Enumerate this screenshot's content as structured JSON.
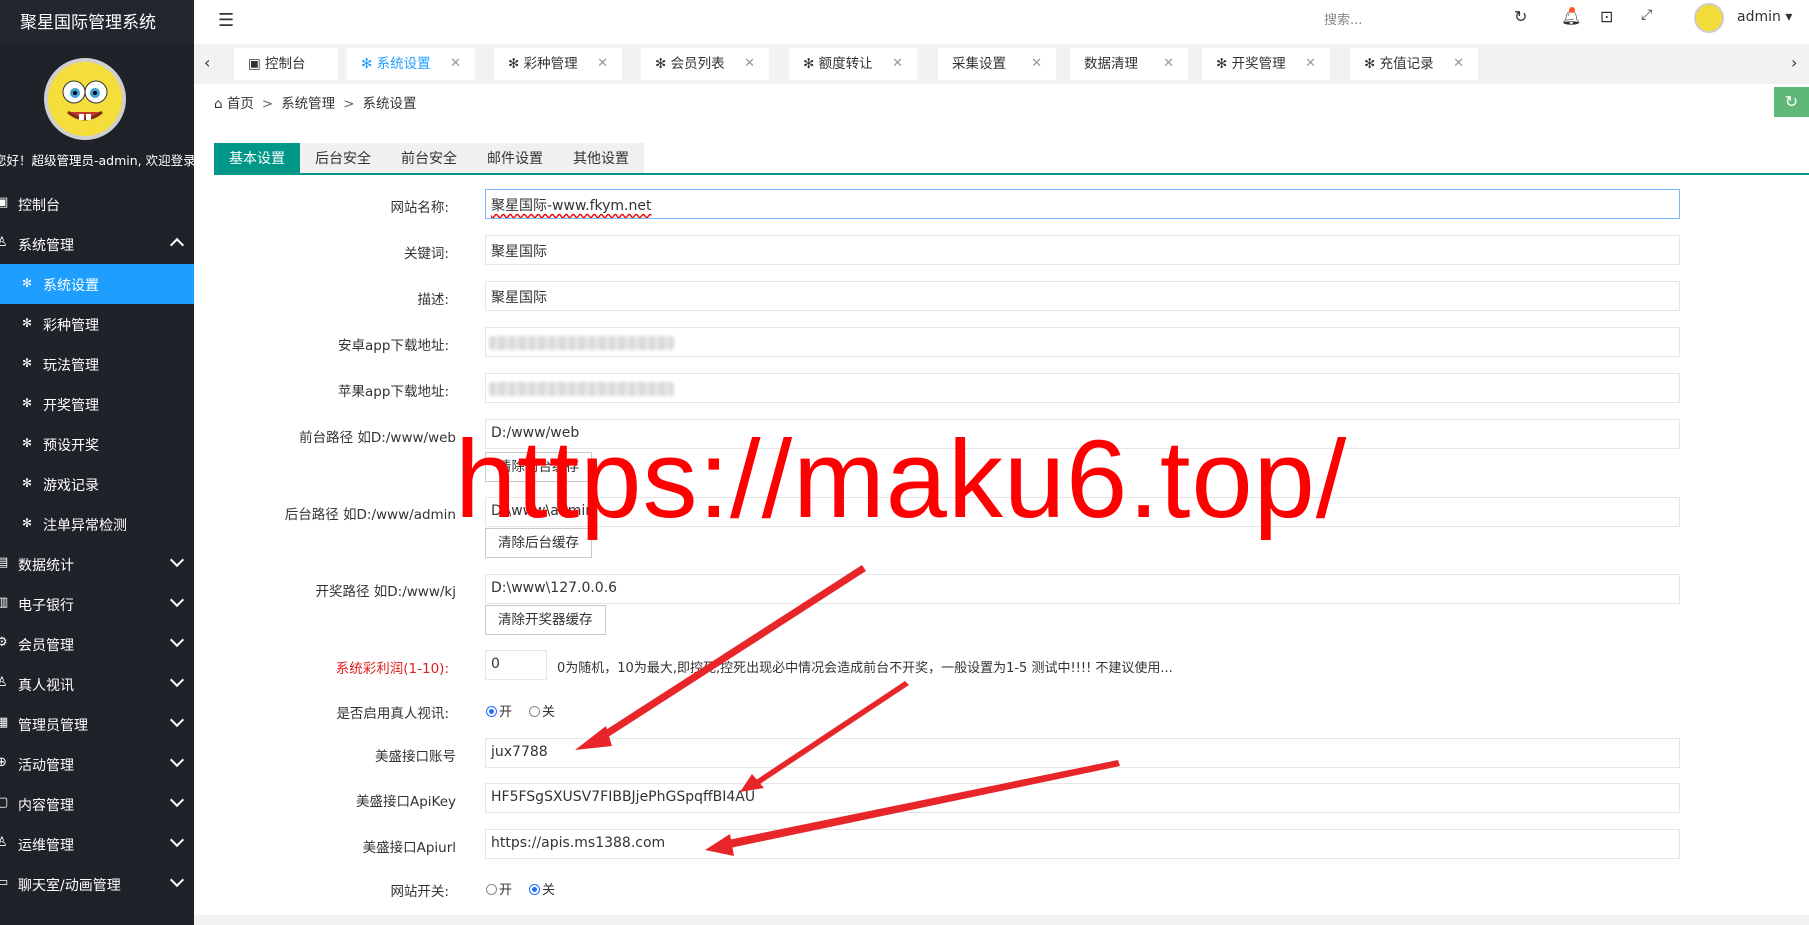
{
  "app": {
    "title": "聚星国际管理系统",
    "welcome": "您好！超级管理员-admin, 欢迎登录"
  },
  "sidebar": {
    "items": [
      {
        "label": "控制台",
        "icon": "monitor-icon"
      },
      {
        "label": "系统管理",
        "icon": "user-icon",
        "expanded": true
      },
      {
        "label": "数据统计",
        "icon": "chart-icon"
      },
      {
        "label": "电子银行",
        "icon": "bank-icon"
      },
      {
        "label": "会员管理",
        "icon": "gear-icon"
      },
      {
        "label": "真人视讯",
        "icon": "user-icon"
      },
      {
        "label": "管理员管理",
        "icon": "id-icon"
      },
      {
        "label": "活动管理",
        "icon": "plus-icon"
      },
      {
        "label": "内容管理",
        "icon": "doc-icon"
      },
      {
        "label": "运维管理",
        "icon": "user-icon"
      },
      {
        "label": "聊天室/动画管理",
        "icon": "chat-icon"
      }
    ],
    "subitems": [
      {
        "label": "系统设置",
        "active": true
      },
      {
        "label": "彩种管理"
      },
      {
        "label": "玩法管理"
      },
      {
        "label": "开奖管理"
      },
      {
        "label": "预设开奖"
      },
      {
        "label": "游戏记录"
      },
      {
        "label": "注单异常检测"
      }
    ]
  },
  "header": {
    "search_placeholder": "搜索...",
    "user": "admin"
  },
  "page_tabs": [
    {
      "label": "控制台"
    },
    {
      "label": "系统设置",
      "active": true
    },
    {
      "label": "彩种管理"
    },
    {
      "label": "会员列表"
    },
    {
      "label": "额度转让"
    },
    {
      "label": "采集设置"
    },
    {
      "label": "数据清理"
    },
    {
      "label": "开奖管理"
    },
    {
      "label": "充值记录"
    }
  ],
  "breadcrumb": {
    "home": "首页",
    "level1": "系统管理",
    "level2": "系统设置"
  },
  "settings_tabs": [
    "基本设置",
    "后台安全",
    "前台安全",
    "邮件设置",
    "其他设置"
  ],
  "form": {
    "site_name": {
      "label": "网站名称:",
      "value": "聚星国际-www.fkym.net"
    },
    "keywords": {
      "label": "关键词:",
      "value": "聚星国际"
    },
    "description": {
      "label": "描述:",
      "value": "聚星国际"
    },
    "android_url": {
      "label": "安卓app下载地址:"
    },
    "ios_url": {
      "label": "苹果app下载地址:"
    },
    "front_path": {
      "label": "前台路径 如D:/www/web",
      "value": "D:/www/web",
      "button": "清除前台缓存"
    },
    "admin_path": {
      "label": "后台路径 如D:/www/admin",
      "value": "D:\\www\\admin",
      "button": "清除后台缓存"
    },
    "kj_path": {
      "label": "开奖路径 如D:/www/kj",
      "value": "D:\\www\\127.0.0.6",
      "button": "清除开奖器缓存"
    },
    "profit": {
      "label": "系统彩利润(1-10):",
      "value": "0",
      "note": "0为随机，10为最大,即控死,控死出现必中情况会造成前台不开奖，一般设置为1-5 测试中!!!! 不建议使用..."
    },
    "live_video": {
      "label": "是否启用真人视讯:",
      "on": "开",
      "off": "关",
      "value": "on"
    },
    "ms_account": {
      "label": "美盛接口账号",
      "value": "jux7788"
    },
    "ms_apikey": {
      "label": "美盛接口ApiKey",
      "value": "HF5FSgSXUSV7FIBBJjePhGSpqffBI4AU"
    },
    "ms_apiurl": {
      "label": "美盛接口Apiurl",
      "value": "https://apis.ms1388.com"
    },
    "site_switch": {
      "label": "网站开关:",
      "on": "开",
      "off": "关",
      "value": "off"
    }
  },
  "watermark": "https://maku6.top/",
  "colors": {
    "sidebar": "#20222a",
    "active": "#1e9fff",
    "tab_active": "#009688",
    "refresh": "#5fb878",
    "annotation": "#ff0000"
  }
}
